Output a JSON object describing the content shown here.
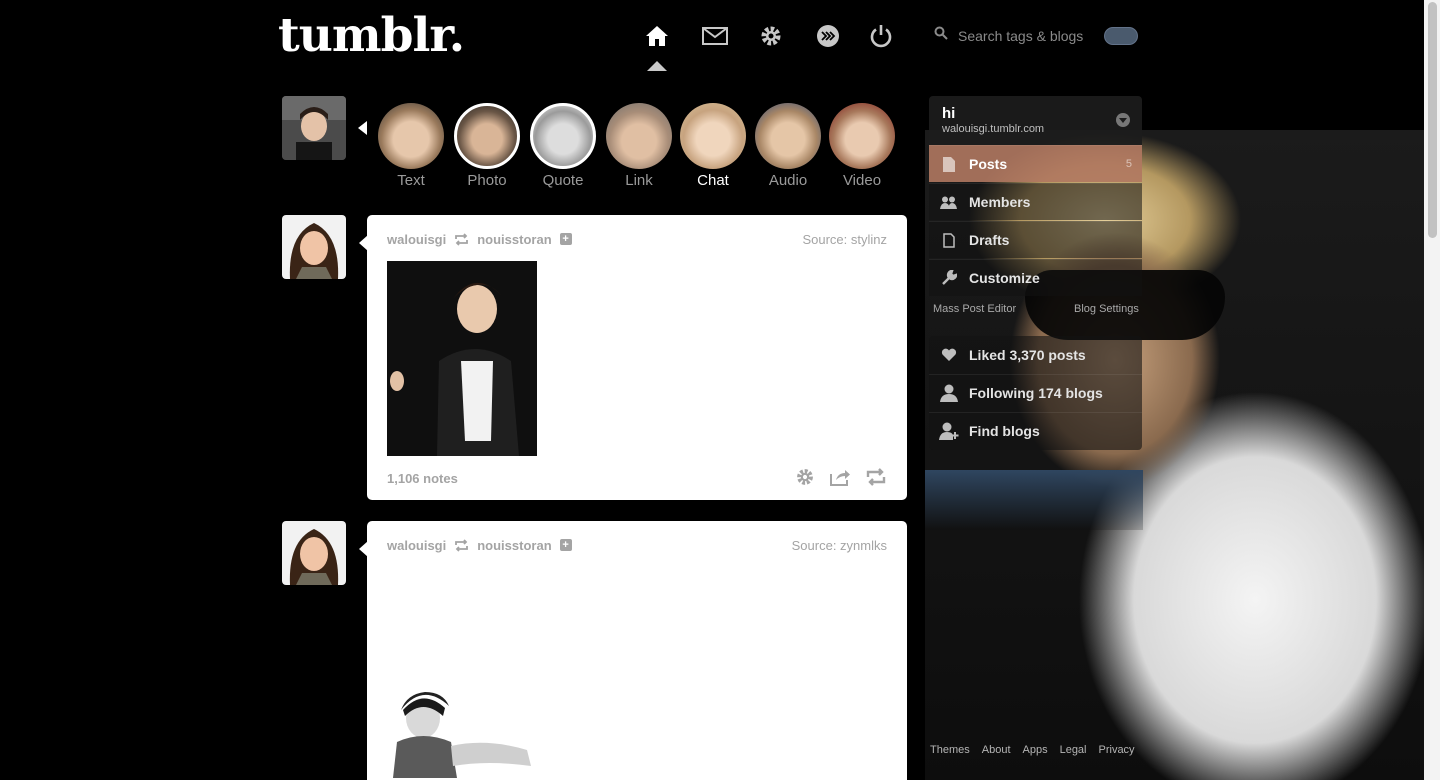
{
  "header": {
    "logo": "tumblr.",
    "nav": [
      {
        "name": "home-icon"
      },
      {
        "name": "mail-icon"
      },
      {
        "name": "gear-icon"
      },
      {
        "name": "radar-icon"
      },
      {
        "name": "power-icon"
      }
    ],
    "search_placeholder": "Search tags & blogs"
  },
  "post_types": [
    {
      "label": "Text"
    },
    {
      "label": "Photo"
    },
    {
      "label": "Quote"
    },
    {
      "label": "Link"
    },
    {
      "label": "Chat",
      "active": true
    },
    {
      "label": "Audio"
    },
    {
      "label": "Video"
    }
  ],
  "posts": [
    {
      "user": "walouisgi",
      "reblogged_from": "nouisstoran",
      "source": "Source: stylinz",
      "notes": "1,106 notes"
    },
    {
      "user": "walouisgi",
      "reblogged_from": "nouisstoran",
      "source": "Source: zynmlks"
    }
  ],
  "sidebar": {
    "blog_title": "hi",
    "blog_url": "walouisgi.tumblr.com",
    "menu": [
      {
        "label": "Posts",
        "count": "5",
        "icon": "document-icon",
        "selected": true
      },
      {
        "label": "Members",
        "icon": "members-icon"
      },
      {
        "label": "Drafts",
        "icon": "draft-icon"
      },
      {
        "label": "Customize",
        "icon": "wrench-icon"
      }
    ],
    "mass_post_editor": "Mass Post Editor",
    "blog_settings": "Blog Settings",
    "account": [
      {
        "label": "Liked 3,370 posts",
        "icon": "heart-icon"
      },
      {
        "label": "Following 174 blogs",
        "icon": "person-icon"
      },
      {
        "label": "Find blogs",
        "icon": "add-person-icon"
      }
    ]
  },
  "footer": [
    "Themes",
    "About",
    "Apps",
    "Legal",
    "Privacy"
  ],
  "colors": {
    "background": "#000000",
    "selected_menu": "#b07860",
    "muted_text": "#a4a4a4"
  }
}
